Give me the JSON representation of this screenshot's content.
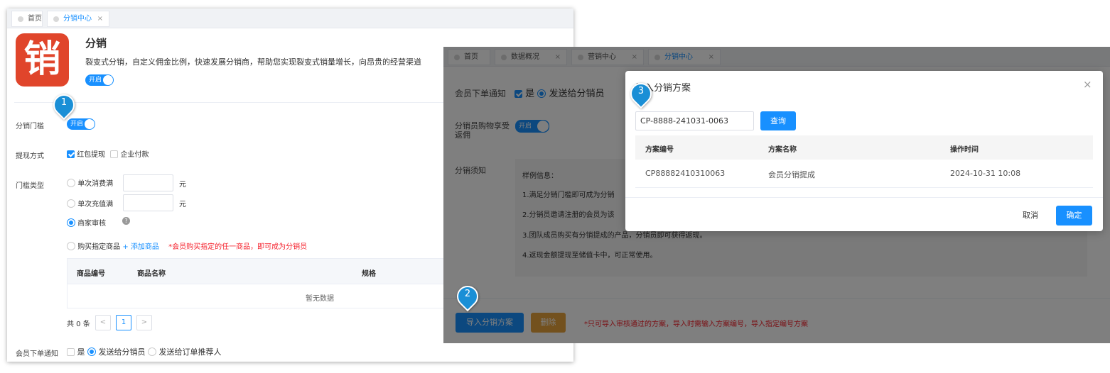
{
  "left": {
    "tabs": [
      {
        "label": "首页"
      },
      {
        "label": "分销中心",
        "close": "×"
      }
    ],
    "app": {
      "logo_char": "销",
      "title": "分销",
      "description": "裂变式分销，自定义佣金比例，快速发展分销商，帮助您实现裂变式销量增长，向昂贵的经营渠道",
      "toggle": "开启"
    },
    "form": {
      "threshold": {
        "label": "分销门槛",
        "toggle": "开启"
      },
      "withdraw": {
        "label": "提现方式",
        "opt1": "红包提现",
        "opt2": "企业付款"
      },
      "type": {
        "label": "门槛类型",
        "single_consume": "单次消费满",
        "single_recharge": "单次充值满",
        "unit": "元",
        "merchant_review": "商家审核",
        "help": "?",
        "buy_product": "购买指定商品",
        "add_product": "+ 添加商品",
        "note": "*会员购买指定的任一商品，即可成为分销员"
      },
      "table": {
        "headers": [
          "商品编号",
          "商品名称",
          "规格"
        ],
        "empty": "暂无数据"
      },
      "pagination": {
        "total": "共 0 条",
        "prev": "<",
        "page": "1",
        "next": ">"
      },
      "notify": {
        "label": "会员下单通知",
        "yes": "是",
        "send_distributor": "发送给分销员",
        "send_referrer": "发送给订单推荐人"
      }
    }
  },
  "right": {
    "tabs": [
      {
        "label": "首页"
      },
      {
        "label": "数据概况",
        "close": "×"
      },
      {
        "label": "营销中心",
        "close": "×"
      },
      {
        "label": "分销中心",
        "close": "×"
      }
    ],
    "notify": {
      "label": "会员下单通知",
      "yes": "是",
      "send": "发送给分销员"
    },
    "rebate": {
      "label": "分销员购物享受返佣",
      "toggle": "开启"
    },
    "notice": {
      "label": "分销须知",
      "lines": [
        "样例信息：",
        "1.满足分销门槛即可成为分销",
        "2.分销员邀请注册的会员为该",
        "3.团队成员购买有分销提成的产品，分销员即可获得返现。",
        "4.返现金额提现至储值卡中，可正常使用。"
      ]
    },
    "buttons": {
      "import": "导入分销方案",
      "delete": "删除",
      "note": "*只可导入审核通过的方案，导入时需输入方案编号，导入指定编号方案"
    },
    "modal": {
      "title": "导入分销方案",
      "close": "×",
      "search_value": "CP-8888-241031-0063",
      "query": "查询",
      "headers": [
        "方案编号",
        "方案名称",
        "操作时间"
      ],
      "rows": [
        [
          "CP88882410310063",
          "会员分销提成",
          "2024-10-31 10:08"
        ]
      ],
      "cancel": "取消",
      "confirm": "确定"
    }
  },
  "markers": [
    "1",
    "2",
    "3"
  ],
  "colors": {
    "primary": "#1890ff",
    "logo": "#e0452b",
    "marker": "#1a8fd6",
    "danger": "#f5222d",
    "delete": "#e6a23c"
  }
}
